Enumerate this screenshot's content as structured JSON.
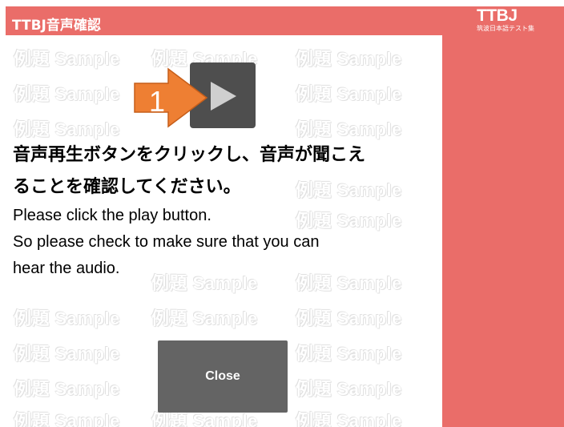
{
  "header": {
    "title": "TTBJ音声確認",
    "logo_main": "TTBJ",
    "logo_sub": "筑波日本語テスト集"
  },
  "watermark": {
    "text": "例題 Sample"
  },
  "play_button": {
    "icon": "play-icon"
  },
  "callout": {
    "number": "1",
    "color": "#ee7f33"
  },
  "instructions": {
    "jp_line1": "音声再生ボタンをクリックし、音声が聞こえ",
    "jp_line2": "ることを確認してください。",
    "en_line1": "Please click the play button.",
    "en_line2": "So please check to make sure that you can",
    "en_line3": "hear the audio."
  },
  "close_button": {
    "label": "Close"
  },
  "colors": {
    "header": "#ea6d69",
    "sidebar": "#ea6d69",
    "button": "#646464",
    "play_button": "#4e4e4e"
  }
}
